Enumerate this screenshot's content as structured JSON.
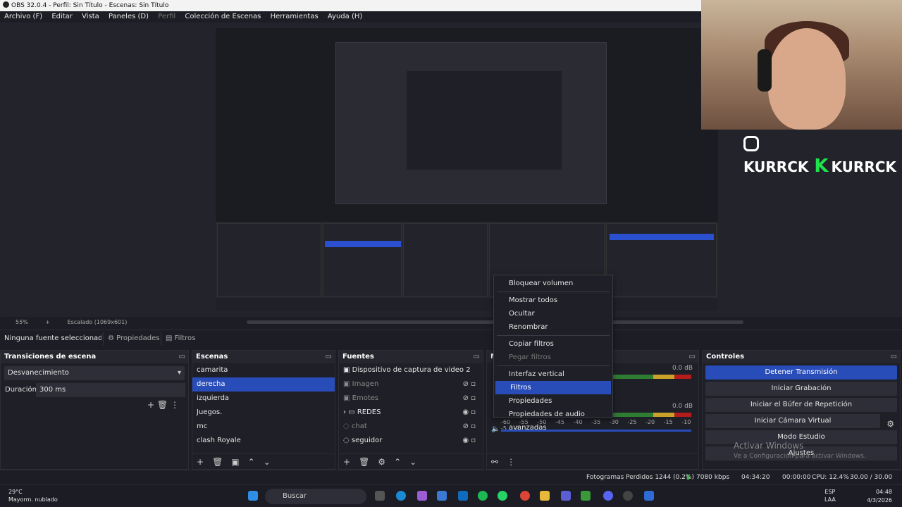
{
  "window": {
    "title": "OBS 32.0.4 - Perfil: Sin Título - Escenas: Sin Título"
  },
  "menu": {
    "file": "Archivo (F)",
    "edit": "Editar",
    "view": "Vista",
    "docks": "Paneles (D)",
    "profile": "Perfil",
    "scenes": "Colección de Escenas",
    "tools": "Herramientas",
    "help": "Ayuda (H)"
  },
  "preview": {
    "zoom": "55%",
    "scaling": "Escalado (1069x601)"
  },
  "banner": {
    "handle1": "KURRCK",
    "handle2": "KURRCK"
  },
  "context": {
    "no_source": "Ninguna fuente seleccionada",
    "properties": "Propiedades",
    "filters": "Filtros"
  },
  "transitions": {
    "title": "Transiciones de escena",
    "selected": "Desvanecimiento",
    "duration_label": "Duración",
    "duration_value": "300 ms"
  },
  "scenes": {
    "title": "Escenas",
    "items": [
      "camarita",
      "derecha",
      "izquierda",
      "Juegos.",
      "mc",
      "clash Royale"
    ]
  },
  "sources": {
    "title": "Fuentes",
    "items": [
      "Dispositivo de captura de video 2",
      "Imagen",
      "Emotes",
      "REDES",
      "chat",
      "seguidor"
    ]
  },
  "mixer": {
    "title": "M",
    "db1": "0.0 dB",
    "db2": "0.0 dB",
    "scale": [
      "-60",
      "-55",
      "-50",
      "-45",
      "-40",
      "-35",
      "-30",
      "-25",
      "-20",
      "-15",
      "-10",
      "-5",
      "0"
    ]
  },
  "controls": {
    "title": "Controles",
    "stop_stream": "Detener Transmisión",
    "start_rec": "Iniciar Grabación",
    "replay": "Iniciar el Búfer de Repetición",
    "vcam": "Iniciar Cámara Virtual",
    "studio": "Modo Estudio",
    "settings": "Ajustes"
  },
  "watermark": {
    "line1": "Activar Windows",
    "line2": "Ve a Configuración para activar Windows."
  },
  "context_menu": {
    "items": [
      "Bloquear volumen",
      "Mostrar todos",
      "Ocultar",
      "Renombrar",
      "Copiar filtros",
      "Pegar filtros",
      "Interfaz vertical",
      "Filtros",
      "Propiedades",
      "Propiedades de audio avanzadas"
    ]
  },
  "statusbar": {
    "dropped": "Fotogramas Perdidos 1244 (0.2%)",
    "bitrate": "7080 kbps",
    "stream_time": "04:34:20",
    "rec_time": "00:00:00",
    "cpu": "CPU: 12.4%",
    "fps": "30.00 / 30.00 FPS"
  },
  "taskbar": {
    "temp": "29°C",
    "weather": "Mayorm. nublado",
    "search": "Buscar",
    "lang1": "ESP",
    "lang2": "LAA",
    "time": "04:48",
    "date": "4/3/2026"
  }
}
